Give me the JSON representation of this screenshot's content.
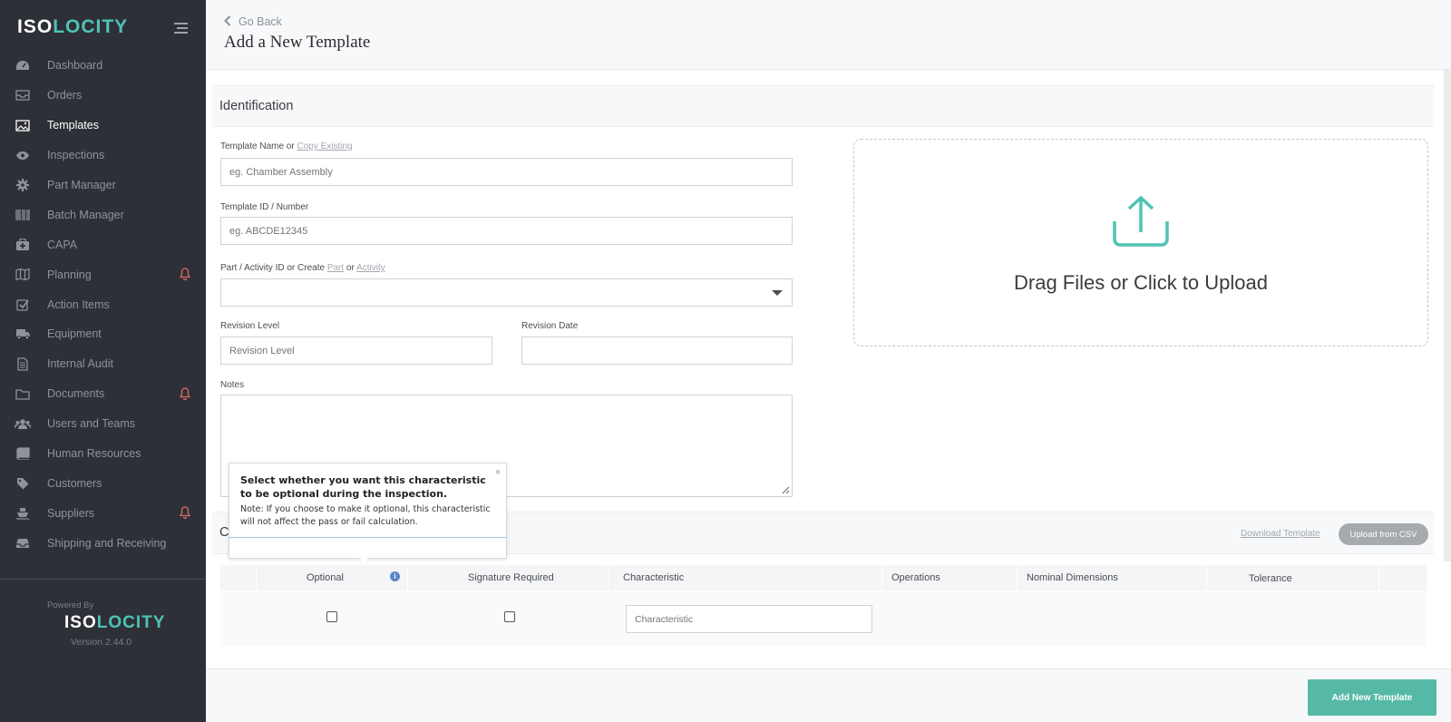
{
  "sidebar": {
    "logo_left": "ISO",
    "logo_right": "LOCITY",
    "items": [
      {
        "label": "Dashboard",
        "icon": "dashboard-icon",
        "active": false
      },
      {
        "label": "Orders",
        "icon": "inbox-icon",
        "active": false
      },
      {
        "label": "Templates",
        "icon": "image-icon",
        "active": true
      },
      {
        "label": "Inspections",
        "icon": "eye-icon",
        "active": false
      },
      {
        "label": "Part Manager",
        "icon": "gear-icon",
        "active": false
      },
      {
        "label": "Batch Manager",
        "icon": "barcode-icon",
        "active": false
      },
      {
        "label": "CAPA",
        "icon": "medkit-icon",
        "active": false
      },
      {
        "label": "Planning",
        "icon": "map-icon",
        "active": false,
        "alert": true
      },
      {
        "label": "Action Items",
        "icon": "checkbox-icon",
        "active": false
      },
      {
        "label": "Equipment",
        "icon": "truck-icon",
        "active": false
      },
      {
        "label": "Internal Audit",
        "icon": "document-icon",
        "active": false
      },
      {
        "label": "Documents",
        "icon": "folder-icon",
        "active": false,
        "alert": true
      },
      {
        "label": "Users and Teams",
        "icon": "users-icon",
        "active": false
      },
      {
        "label": "Human Resources",
        "icon": "book-icon",
        "active": false
      },
      {
        "label": "Customers",
        "icon": "tag-icon",
        "active": false
      },
      {
        "label": "Suppliers",
        "icon": "ship-icon",
        "active": false,
        "alert": true
      },
      {
        "label": "Shipping and Receiving",
        "icon": "tray-icon",
        "active": false
      }
    ],
    "powered_by": "Powered By",
    "version": "Version 2.44.0"
  },
  "header": {
    "go_back": "Go Back",
    "title": "Add a New Template"
  },
  "identification": {
    "section_title": "Identification",
    "template_name_label": "Template Name or ",
    "copy_existing_link": "Copy Existing",
    "template_name_placeholder": "eg. Chamber Assembly",
    "template_id_label": "Template ID / Number",
    "template_id_placeholder": "eg. ABCDE12345",
    "part_label": "Part / Activity ID or Create ",
    "part_link": "Part",
    "or_text": " or ",
    "activity_link": "Activity",
    "revision_level_label": "Revision Level",
    "revision_level_placeholder": "Revision Level",
    "revision_date_label": "Revision Date",
    "notes_label": "Notes"
  },
  "upload": {
    "text": "Drag Files or Click to Upload",
    "accent": "#4fc3b6"
  },
  "characteristics": {
    "section_letter": "C",
    "download_template": "Download Template",
    "upload_csv": "Upload from CSV",
    "columns": [
      "Optional",
      "Signature Required",
      "Characteristic",
      "Operations",
      "Nominal Dimensions",
      "Tolerance"
    ],
    "characteristic_placeholder": "Characteristic"
  },
  "tooltip": {
    "close": "×",
    "title": "Select whether you want this characteristic to be optional during the inspection.",
    "body": "Note: If you choose to make it optional, this characteristic will not affect the pass or fail calculation."
  },
  "footer": {
    "add_button": "Add New Template",
    "button_color": "#55b9a6"
  }
}
